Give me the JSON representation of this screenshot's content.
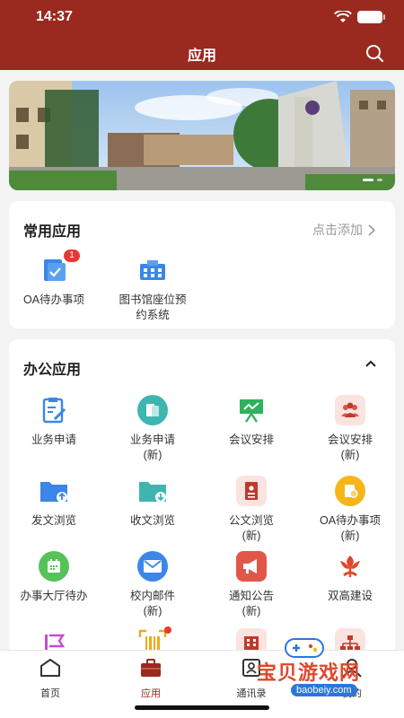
{
  "status_bar": {
    "time": "14:37"
  },
  "nav": {
    "title": "应用"
  },
  "common": {
    "title": "常用应用",
    "add_label": "点击添加",
    "apps": [
      {
        "label": "OA待办事项",
        "badge": "1",
        "icon": "oa-todo-icon"
      },
      {
        "label": "图书馆座位预\n约系统",
        "icon": "library-seat-icon"
      }
    ]
  },
  "office": {
    "title": "办公应用",
    "apps": [
      {
        "label": "业务申请",
        "icon": "edit-doc-icon"
      },
      {
        "label": "业务申请\n(新)",
        "icon": "book-icon"
      },
      {
        "label": "会议安排",
        "icon": "presentation-icon"
      },
      {
        "label": "会议安排\n(新)",
        "icon": "people-icon"
      },
      {
        "label": "发文浏览",
        "icon": "folder-upload-icon"
      },
      {
        "label": "收文浏览",
        "icon": "folder-download-icon"
      },
      {
        "label": "公文浏览\n(新)",
        "icon": "document-icon"
      },
      {
        "label": "OA待办事项\n(新)",
        "icon": "oa-todo-new-icon"
      },
      {
        "label": "办事大厅待办",
        "icon": "calendar-icon"
      },
      {
        "label": "校内邮件\n(新)",
        "icon": "mail-icon"
      },
      {
        "label": "通知公告\n(新)",
        "icon": "megaphone-icon"
      },
      {
        "label": "双高建设",
        "icon": "flower-icon"
      },
      {
        "label": "",
        "icon": "flag-icon"
      },
      {
        "label": "",
        "icon": "scan-icon"
      },
      {
        "label": "",
        "icon": "building-icon"
      },
      {
        "label": "",
        "icon": "org-chart-icon"
      }
    ]
  },
  "tabbar": {
    "items": [
      {
        "label": "首页",
        "icon": "home-icon"
      },
      {
        "label": "应用",
        "icon": "briefcase-icon"
      },
      {
        "label": "通讯录",
        "icon": "contacts-icon"
      },
      {
        "label": "我的",
        "icon": "user-icon"
      }
    ],
    "active": "应用"
  },
  "watermark": {
    "text": "宝贝游戏网",
    "url": "baobeiy.com"
  },
  "colors": {
    "brand": "#9a2a1f",
    "badge": "#e53935",
    "blue": "#3b86e8",
    "teal": "#3fb5b0",
    "green": "#2db35a",
    "red": "#e0574a"
  }
}
